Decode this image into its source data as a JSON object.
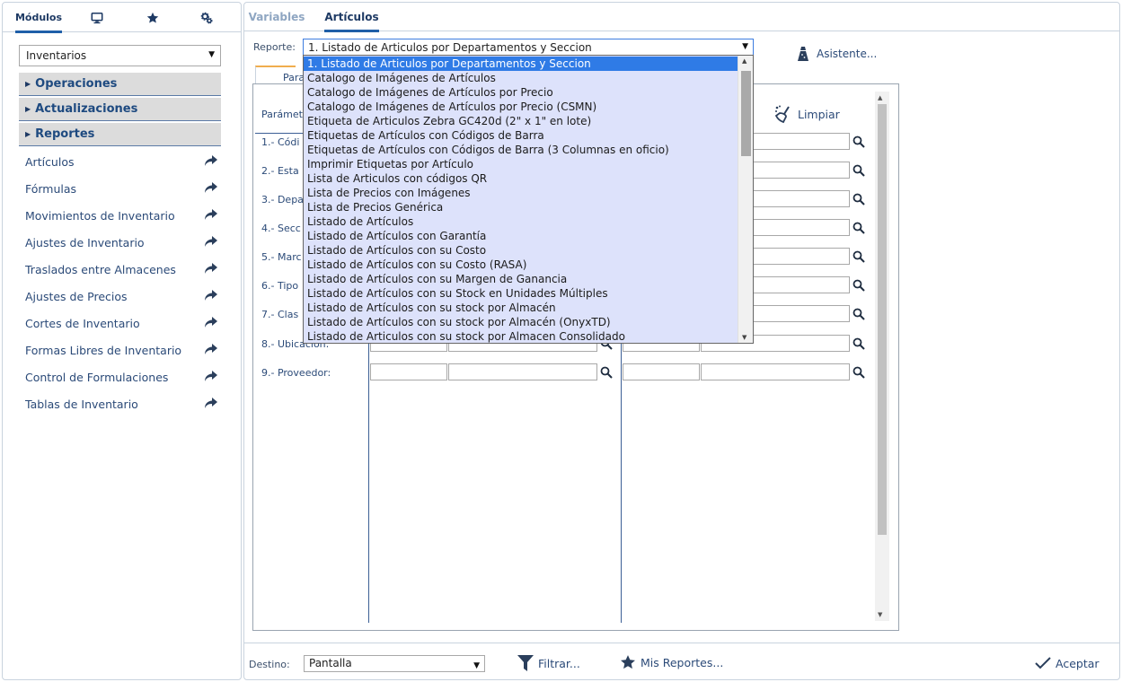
{
  "sidebar": {
    "tabs": [
      {
        "label": "Módulos",
        "active": true
      },
      {
        "icon": "monitor-icon"
      },
      {
        "icon": "star-icon"
      },
      {
        "icon": "settings-gears-icon"
      }
    ],
    "module_select": "Inventarios",
    "sections": [
      "Operaciones",
      "Actualizaciones",
      "Reportes"
    ],
    "items": [
      {
        "label": "Artículos"
      },
      {
        "label": "Fórmulas"
      },
      {
        "label": "Movimientos de Inventario"
      },
      {
        "label": "Ajustes de Inventario"
      },
      {
        "label": "Traslados entre Almacenes"
      },
      {
        "label": "Ajustes de Precios"
      },
      {
        "label": "Cortes de Inventario"
      },
      {
        "label": "Formas Libres de Inventario"
      },
      {
        "label": "Control de Formulaciones"
      },
      {
        "label": "Tablas de Inventario"
      }
    ]
  },
  "main": {
    "tabs": [
      {
        "label": "Variables",
        "active": false
      },
      {
        "label": "Artículos",
        "active": true
      }
    ],
    "report_label": "Reporte:",
    "report_selected": "1. Listado de Articulos por Departamentos y Seccion",
    "asistente_label": "Asistente...",
    "subtab_label": "Para",
    "params_header": "Parámet",
    "limpiar_label": "Limpiar",
    "params": [
      {
        "label": "1.- Códi"
      },
      {
        "label": "2.- Esta"
      },
      {
        "label": "3.- Depa"
      },
      {
        "label": "4.- Secc"
      },
      {
        "label": "5.- Marc"
      },
      {
        "label": "6.- Tipo"
      },
      {
        "label": "7.- Clas"
      },
      {
        "label": "8.- Ubicación:"
      },
      {
        "label": "9.- Proveedor:"
      }
    ],
    "dropdown_options": [
      "1. Listado de Articulos por Departamentos y Seccion",
      "Catalogo de Imágenes de Artículos",
      "Catalogo de Imágenes de Artículos por Precio",
      "Catalogo de Imágenes de Artículos por Precio (CSMN)",
      "Etiqueta de Articulos Zebra GC420d (2\" x 1\" en lote)",
      "Etiquetas de Artículos con Códigos de Barra",
      "Etiquetas de Artículos con Códigos de Barra (3 Columnas en oficio)",
      "Imprimir Etiquetas por Artículo",
      "Lista de Articulos con códigos QR",
      "Lista de Precios con Imágenes",
      "Lista de Precios Genérica",
      "Listado de Artículos",
      "Listado de Artículos con Garantía",
      "Listado de Artículos con su Costo",
      "Listado de Artículos con su Costo (RASA)",
      "Listado de Artículos con su Margen de Ganancia",
      "Listado de Artículos con su Stock en Unidades Múltiples",
      "Listado de Artículos con su stock por Almacén",
      "Listado de Artículos con su stock por Almacén (OnyxTD)",
      "Listado de Articulos con su stock por Almacen Consolidado"
    ]
  },
  "footer": {
    "destino_label": "Destino:",
    "destino_value": "Pantalla",
    "filtrar_label": "Filtrar...",
    "mis_reportes_label": "Mis Reportes...",
    "aceptar_label": "Aceptar"
  },
  "colors": {
    "accent": "#1f5fa8",
    "selection": "#2f7be6",
    "dropdown_bg": "#dde2fb",
    "subtab_accent": "#f0ad4e"
  }
}
